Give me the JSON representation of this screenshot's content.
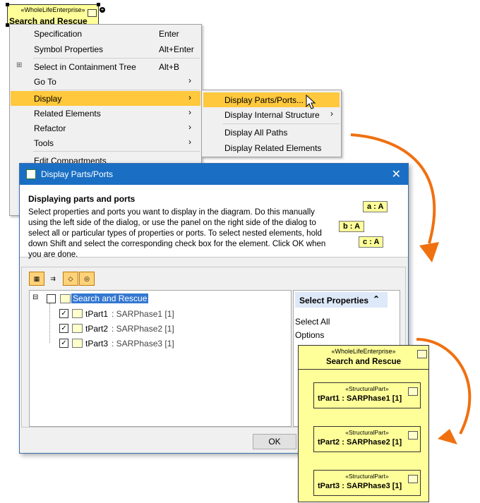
{
  "top_block": {
    "stereotype": "«WholeLifeEnterprise»",
    "name": "Search and Rescue"
  },
  "menu": {
    "items": [
      {
        "label": "Specification",
        "shortcut": "Enter"
      },
      {
        "label": "Symbol Properties",
        "shortcut": "Alt+Enter"
      },
      {
        "label": "Select in Containment Tree",
        "shortcut": "Alt+B"
      },
      {
        "label": "Go To",
        "arrow": "›"
      },
      {
        "label": "Display",
        "arrow": "›"
      },
      {
        "label": "Related Elements",
        "arrow": "›"
      },
      {
        "label": "Refactor",
        "arrow": "›"
      },
      {
        "label": "Tools",
        "arrow": "›"
      },
      {
        "label": "Edit Compartments"
      }
    ]
  },
  "submenu": {
    "items": [
      {
        "label": "Display Parts/Ports..."
      },
      {
        "label": "Display Internal Structure",
        "arrow": "›"
      },
      {
        "label": "Display All Paths"
      },
      {
        "label": "Display Related Elements"
      }
    ]
  },
  "dialog": {
    "title": "Display Parts/Ports",
    "close": "✕",
    "heading": "Displaying parts and ports",
    "description": "Select properties and ports you want to display in the diagram. Do this manually using the left side of the dialog, or use the panel on the right side of the dialog to select all or particular types of properties or ports. To select nested elements, hold down Shift and select the corresponding check box for the element. Click OK when you are done.",
    "chips": [
      "a : A",
      "b : A",
      "c : A"
    ],
    "tree": {
      "root": "Search and Rescue",
      "children": [
        {
          "name": "tPart1",
          "type": " : SARPhase1 [1]"
        },
        {
          "name": "tPart2",
          "type": " : SARPhase2 [1]"
        },
        {
          "name": "tPart3",
          "type": " : SARPhase3 [1]"
        }
      ]
    },
    "props": {
      "header": "Select Properties",
      "select_all": "Select All",
      "options": "Options"
    },
    "ok": "OK"
  },
  "result": {
    "stereotype": "«WholeLifeEnterprise»",
    "name": "Search and Rescue",
    "parts": [
      {
        "stereotype": "«StructuralPart»",
        "name": "tPart1 : SARPhase1 [1]"
      },
      {
        "stereotype": "«StructuralPart»",
        "name": "tPart2 : SARPhase2 [1]"
      },
      {
        "stereotype": "«StructuralPart»",
        "name": "tPart3 : SARPhase3 [1]"
      }
    ]
  },
  "colors": {
    "highlight": "#ffc83d",
    "block_fill": "#ffff99",
    "arrow": "#f07010",
    "titlebar": "#1a6fc4"
  }
}
